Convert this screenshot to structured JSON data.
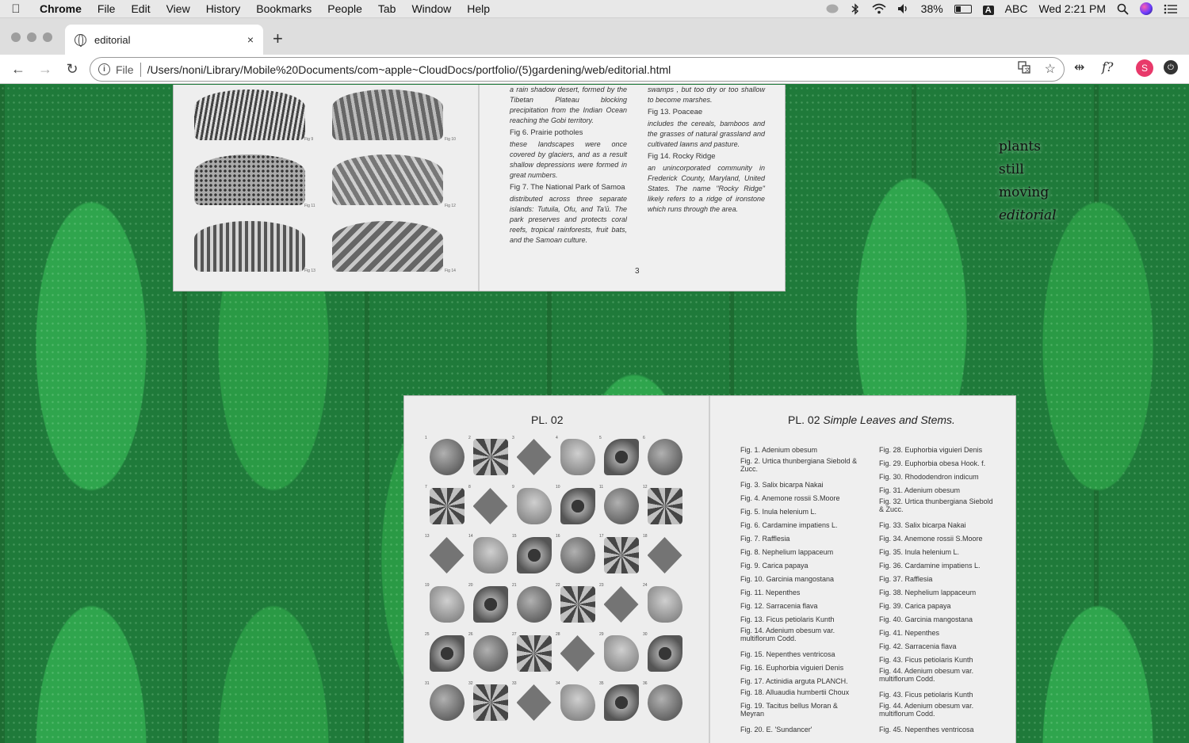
{
  "menubar": {
    "app": "Chrome",
    "items": [
      "File",
      "Edit",
      "View",
      "History",
      "Bookmarks",
      "People",
      "Tab",
      "Window",
      "Help"
    ],
    "battery": "38%",
    "battery_level": 0.38,
    "input_source": "ABC",
    "clock": "Wed 2:21 PM"
  },
  "tab": {
    "title": "editorial",
    "close": "×",
    "new": "+"
  },
  "toolbar": {
    "back": "←",
    "forward": "→",
    "reload": "↻",
    "scheme": "File",
    "url": "/Users/noni/Library/Mobile%20Documents/com~apple~CloudDocs/portfolio/(5)gardening/web/editorial.html",
    "profile_initial": "S",
    "ext_function": "f?"
  },
  "site_nav": {
    "items": [
      "plants",
      "still",
      "moving",
      "editorial"
    ]
  },
  "spread1": {
    "col1": [
      {
        "text": "a rain shadow desert, formed by the Tibetan Plateau blocking precipitation from the Indian Ocean reaching the Gobi territory."
      },
      {
        "fig": "Fig 6. Prairie potholes"
      },
      {
        "text": "these landscapes were once covered by glaciers, and as a result shallow depressions were formed in great numbers."
      },
      {
        "fig": "Fig 7. The National Park of Samoa"
      },
      {
        "text": "distributed across three separate islands: Tutuila, Ofu, and Ta'ū. The park preserves and protects coral reefs, tropical rainforests, fruit bats, and the Samoan culture."
      }
    ],
    "col2": [
      {
        "text": "swamps , but too dry or too shallow to become marshes."
      },
      {
        "fig": "Fig 13. Poaceae"
      },
      {
        "text": "includes the cereals, bamboos and the grasses of natural grassland and cultivated lawns and pasture."
      },
      {
        "fig": "Fig 14. Rocky Ridge"
      },
      {
        "text": "an unincorporated community in Frederick County, Maryland, United States. The name \"Rocky Ridge\" likely refers to a ridge of ironstone which runs through the area."
      }
    ],
    "page_number": "3",
    "fig_tags": [
      "Fig 9",
      "Fig 10",
      "Fig 11",
      "Fig 12",
      "Fig 13",
      "Fig 14"
    ]
  },
  "spread2": {
    "left_title": "PL. 02",
    "right_title_plain": "PL. 02 ",
    "right_title_italic": "Simple Leaves and Stems.",
    "col1": [
      "Fig. 1.  Adenium obesum",
      "Fig. 2.  Urtica thunbergiana Siebold & Zucc.",
      "Fig. 3.  Salix bicarpa Nakai",
      "Fig. 4.  Anemone rossii S.Moore",
      "Fig. 5.  Inula helenium L.",
      "Fig. 6.  Cardamine impatiens L.",
      "Fig. 7.  Rafflesia",
      "Fig. 8.  Nephelium lappaceum",
      "Fig. 9.  Carica papaya",
      "Fig. 10.  Garcinia mangostana",
      "Fig. 11.  Nepenthes",
      "Fig. 12.  Sarracenia flava",
      "Fig. 13.  Ficus petiolaris Kunth",
      "Fig. 14.  Adenium obesum var. multiflorum Codd.",
      "Fig. 15.  Nepenthes ventricosa",
      "Fig. 16.  Euphorbia viguieri Denis",
      "Fig. 17.  Actinidia arguta PLANCH.",
      "Fig. 18.  Alluaudia humbertii Choux",
      "Fig. 19.  Tacitus bellus Moran & Meyran",
      "Fig. 20.  E. 'Sundancer'"
    ],
    "col2": [
      "Fig. 28.  Euphorbia viguieri Denis",
      "Fig. 29.  Euphorbia obesa Hook. f.",
      "Fig. 30.  Rhododendron indicum",
      "Fig. 31.  Adenium obesum",
      "Fig. 32.  Urtica thunbergiana Siebold & Zucc.",
      "Fig. 33.  Salix bicarpa Nakai",
      "Fig. 34.  Anemone rossii S.Moore",
      "Fig. 35.  Inula helenium L.",
      "Fig. 36.  Cardamine impatiens L.",
      "Fig. 37.  Rafflesia",
      "Fig. 38.  Nephelium lappaceum",
      "Fig. 39.  Carica papaya",
      "Fig. 40.  Garcinia mangostana",
      "Fig. 41. Nepenthes",
      "Fig. 42.  Sarracenia flava",
      "Fig. 43.  Ficus petiolaris Kunth",
      "Fig. 44.  Adenium obesum var. multiflorum Codd.",
      "Fig. 43.  Ficus petiolaris Kunth",
      "Fig. 44.  Adenium obesum var. multiflorum Codd.",
      "Fig. 45.  Nepenthes ventricosa"
    ],
    "leaf_numbers": [
      "1",
      "2",
      "3",
      "4",
      "5",
      "6",
      "7",
      "8",
      "9",
      "10",
      "11",
      "12",
      "13",
      "14",
      "15",
      "16",
      "17",
      "18",
      "19",
      "20",
      "21",
      "22",
      "23",
      "24",
      "25",
      "26",
      "27",
      "28",
      "29",
      "30",
      "31",
      "32",
      "33",
      "34",
      "35",
      "36"
    ]
  },
  "icons": {
    "menubar": [
      "apple-icon",
      "chat-icon",
      "bluetooth-icon",
      "wifi-icon",
      "volume-icon",
      "battery-icon",
      "input-source-icon",
      "spotlight-icon",
      "siri-icon",
      "notification-center-icon"
    ],
    "browser": [
      "globe-icon",
      "close-icon",
      "plus-icon",
      "back-icon",
      "forward-icon",
      "reload-icon",
      "info-icon",
      "translate-icon",
      "star-icon",
      "extension-icon",
      "profile-icon",
      "power-icon"
    ]
  },
  "colors": {
    "background_green": "#1f7a3a",
    "profile": "#e8396a"
  }
}
